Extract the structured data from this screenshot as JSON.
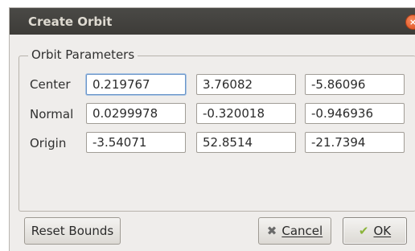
{
  "window": {
    "title": "Create Orbit",
    "close_glyph": "×"
  },
  "group": {
    "legend": "Orbit Parameters"
  },
  "rows": [
    {
      "label": "Center",
      "values": [
        "0.219767",
        "3.76082",
        "-5.86096"
      ]
    },
    {
      "label": "Normal",
      "values": [
        "0.0299978",
        "-0.320018",
        "-0.946936"
      ]
    },
    {
      "label": "Origin",
      "values": [
        "-3.54071",
        "52.8514",
        "-21.7394"
      ]
    }
  ],
  "buttons": {
    "reset_bounds": "Reset Bounds",
    "cancel": "Cancel",
    "ok": "OK",
    "cancel_icon": "✖",
    "ok_icon": "✔"
  },
  "icons": {
    "close": "close-icon",
    "cancel": "cancel-icon",
    "ok": "checkmark-icon"
  },
  "colors": {
    "titlebar": "#3d3c38",
    "close_button": "#df4a16",
    "focus_border": "#6b96c9",
    "ok_check": "#8ab43a"
  }
}
